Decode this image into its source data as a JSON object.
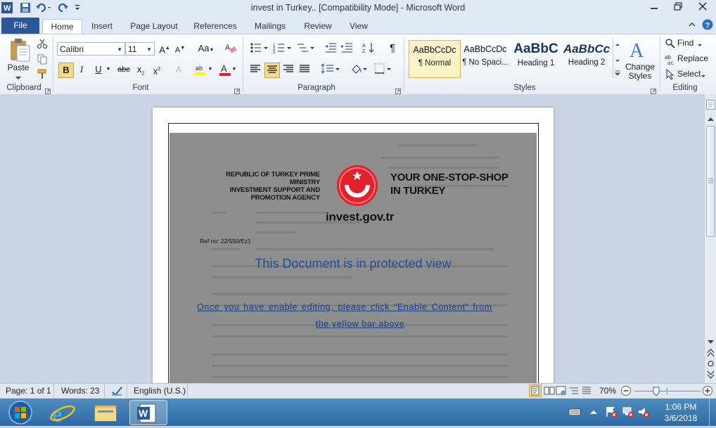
{
  "window": {
    "title": "invest in Turkey.. [Compatibility Mode]  -  Microsoft Word"
  },
  "menu": {
    "tabs": [
      "File",
      "Home",
      "Insert",
      "Page Layout",
      "References",
      "Mailings",
      "Review",
      "View"
    ]
  },
  "ribbon": {
    "clipboard": {
      "paste_label": "Paste",
      "group_label": "Clipboard"
    },
    "font": {
      "font_name": "Calibri",
      "font_size": "11",
      "group_label": "Font"
    },
    "paragraph": {
      "group_label": "Paragraph"
    },
    "styles": {
      "group_label": "Styles",
      "items": [
        {
          "sample": "AaBbCcDc",
          "name": "¶ Normal"
        },
        {
          "sample": "AaBbCcDc",
          "name": "¶ No Spaci..."
        },
        {
          "sample": "AaBbC",
          "name": "Heading 1"
        },
        {
          "sample": "AaBbCc",
          "name": "Heading 2"
        }
      ],
      "change_styles_label": "Change Styles"
    },
    "editing": {
      "group_label": "Editing",
      "find_label": "Find",
      "replace_label": "Replace",
      "select_label": "Select"
    }
  },
  "document": {
    "agency_line1": "REPUBLIC OF TURKEY PRIME MINISTRY",
    "agency_line2": "INVESTMENT SUPPORT AND",
    "agency_line3": "PROMOTION AGENCY",
    "slogan_line1": "YOUR ONE-STOP-SHOP",
    "slogan_line2": "IN TURKEY",
    "website": "invest.gov.tr",
    "ref_no": "Ref no: 22/550/Ez1",
    "protected_heading": "This Document is in protected view",
    "instruction_line1": "Once you have enable editing, please click “Enable Content” from",
    "instruction_line2": "the yellow bar above"
  },
  "statusbar": {
    "page": "Page: 1 of 1",
    "words": "Words: 23",
    "language": "English (U.S.)",
    "zoom": "70%"
  },
  "taskbar": {
    "time": "1:06 PM",
    "date": "3/6/2018"
  },
  "colors": {
    "file_tab": "#2b579a",
    "heading_blue": "#1f4e9a",
    "link_blue": "#1a3e8a",
    "logo_red": "#e3212a"
  }
}
